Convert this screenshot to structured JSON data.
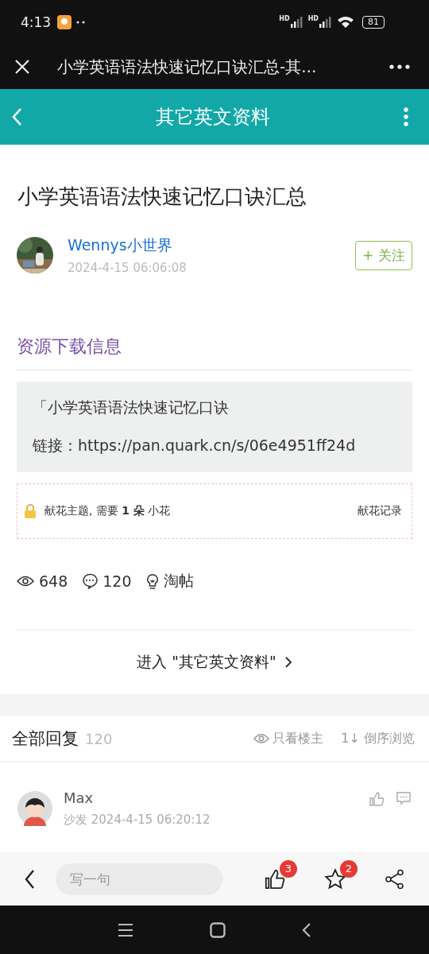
{
  "status_bar": {
    "time": "4:13",
    "signal_labels": [
      "HD",
      "HD"
    ],
    "battery": "81"
  },
  "browser_bar": {
    "title": "小学英语语法快速记忆口诀汇总-其..."
  },
  "header": {
    "title": "其它英文资料"
  },
  "post": {
    "title": "小学英语语法快速记忆口诀汇总",
    "author": {
      "name": "Wennys小世界",
      "time": "2024-4-15 06:06:08",
      "follow": "+ 关注"
    },
    "section_title": "资源下载信息",
    "resource_lines": [
      "「小学英语语法快速记忆口诀",
      "链接：https://pan.quark.cn/s/06e4951ff24d"
    ],
    "gift": {
      "text": "献花主题, 需要 **1 朵** 小花",
      "record": "献花记录"
    },
    "stats": [
      {
        "kind": "views",
        "text": "648"
      },
      {
        "kind": "comments",
        "text": "120"
      },
      {
        "kind": "tao",
        "text": "淘帖"
      }
    ],
    "forum_link": "进入 \"其它英文资料\""
  },
  "replies": {
    "title": "全部回复",
    "count": "120",
    "actions": [
      {
        "kind": "owner",
        "label": "只看楼主"
      },
      {
        "kind": "sort",
        "label": "1↓ 倒序浏览"
      }
    ],
    "items": [
      {
        "name": "Max",
        "meta": "沙发 2024-4-15 06:20:12"
      }
    ]
  },
  "bottom_bar": {
    "placeholder": "写一句",
    "like_count": "3",
    "star_count": "2"
  }
}
